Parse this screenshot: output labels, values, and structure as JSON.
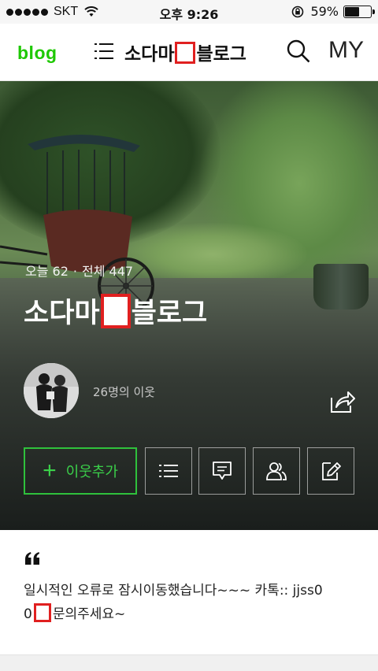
{
  "status_bar": {
    "carrier": "SKT",
    "time": "오후 9:26",
    "battery_percent": "59%",
    "battery_level": 0.59
  },
  "header": {
    "logo": "blog",
    "title_prefix": "소다마",
    "title_suffix": "블로그",
    "my_label": "MY",
    "icons": [
      "menu-icon",
      "search-icon"
    ]
  },
  "cover": {
    "today_label": "오늘 62",
    "total_label": "전체 447",
    "separator": "·",
    "title_prefix": "소다마",
    "title_suffix": "블로그",
    "neighbors_label": "26명의 이웃",
    "add_neighbor_label": "이웃추가",
    "icons": [
      "share-icon",
      "list-icon",
      "comment-icon",
      "neighbors-icon",
      "write-icon"
    ]
  },
  "intro": {
    "line1": "일시적인 오류로 잠시이동했습니다~~~ 카톡:: jjss0",
    "line2_prefix": "0",
    "line2_suffix": "문의주세요~"
  },
  "colors": {
    "brand_green": "#1ec800",
    "button_green": "#2fc13c",
    "redaction_red": "#e02020"
  }
}
